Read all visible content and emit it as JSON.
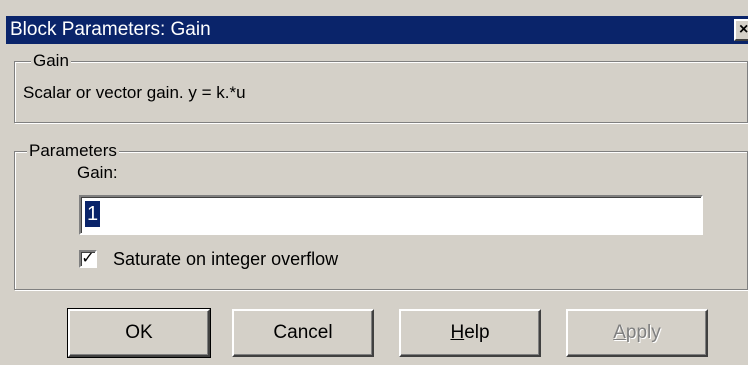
{
  "window": {
    "title": "Block Parameters: Gain",
    "close_glyph": "×"
  },
  "description_group": {
    "legend": "Gain",
    "description": "Scalar or vector gain. y = k.*u"
  },
  "parameters_group": {
    "legend": "Parameters",
    "gain_label": "Gain:",
    "gain_value": "1",
    "saturate_checked": true,
    "saturate_label": "Saturate on integer overflow"
  },
  "buttons": {
    "ok": "OK",
    "cancel": "Cancel",
    "help_mnemonic": "H",
    "help_rest": "elp",
    "apply_mnemonic": "A",
    "apply_rest": "pply"
  },
  "colors": {
    "title_bar": "#0a246a",
    "face": "#d4d0c8",
    "disabled_text": "#808080"
  }
}
